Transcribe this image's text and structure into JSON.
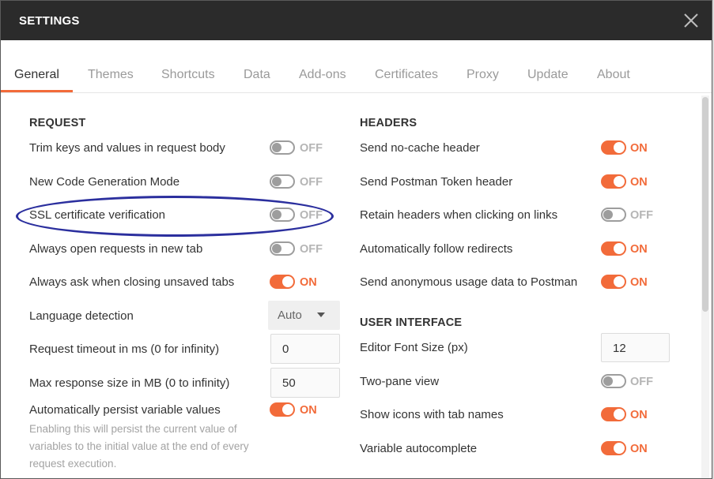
{
  "window": {
    "title": "SETTINGS"
  },
  "tabs": [
    "General",
    "Themes",
    "Shortcuts",
    "Data",
    "Add-ons",
    "Certificates",
    "Proxy",
    "Update",
    "About"
  ],
  "request": {
    "title": "REQUEST",
    "trim": {
      "label": "Trim keys and values in request body",
      "state": "OFF"
    },
    "codegen": {
      "label": "New Code Generation Mode",
      "state": "OFF"
    },
    "ssl": {
      "label": "SSL certificate verification",
      "state": "OFF"
    },
    "newtab": {
      "label": "Always open requests in new tab",
      "state": "OFF"
    },
    "askclose": {
      "label": "Always ask when closing unsaved tabs",
      "state": "ON"
    },
    "language": {
      "label": "Language detection",
      "value": "Auto"
    },
    "timeout": {
      "label": "Request timeout in ms (0 for infinity)",
      "value": "0"
    },
    "maxsize": {
      "label": "Max response size in MB (0 to infinity)",
      "value": "50"
    },
    "persist": {
      "label": "Automatically persist variable values",
      "state": "ON",
      "help": "Enabling this will persist the current value of variables to the initial value at the end of every request execution."
    }
  },
  "headers": {
    "title": "HEADERS",
    "nocache": {
      "label": "Send no-cache header",
      "state": "ON"
    },
    "token": {
      "label": "Send Postman Token header",
      "state": "ON"
    },
    "retain": {
      "label": "Retain headers when clicking on links",
      "state": "OFF"
    },
    "redirects": {
      "label": "Automatically follow redirects",
      "state": "ON"
    },
    "anon": {
      "label": "Send anonymous usage data to Postman",
      "state": "ON"
    }
  },
  "ui": {
    "title": "USER INTERFACE",
    "fontsize": {
      "label": "Editor Font Size (px)",
      "value": "12"
    },
    "twopane": {
      "label": "Two-pane view",
      "state": "OFF"
    },
    "icons": {
      "label": "Show icons with tab names",
      "state": "ON"
    },
    "autocomplete": {
      "label": "Variable autocomplete",
      "state": "ON"
    }
  },
  "colors": {
    "accent": "#f26b3a",
    "titlebar": "#2b2b2b",
    "highlight_oval": "#2b2f9e"
  }
}
